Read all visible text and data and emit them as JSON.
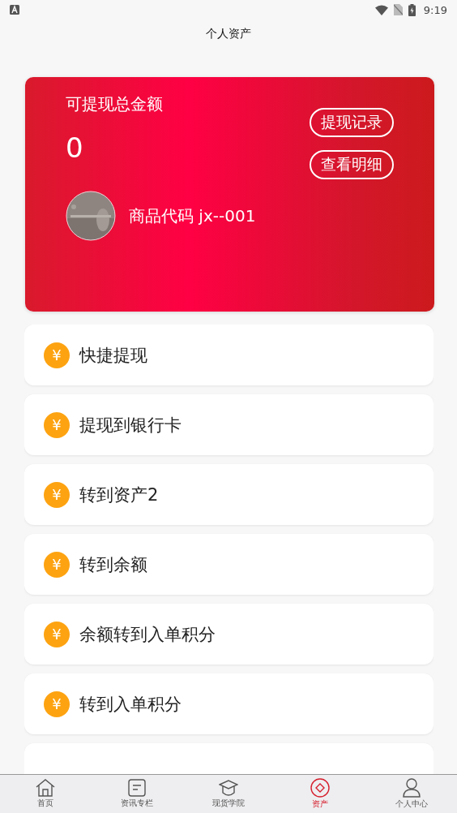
{
  "status_bar": {
    "time": "9:19"
  },
  "header": {
    "title": "个人资产"
  },
  "balance_card": {
    "label": "可提现总金额",
    "amount": "0",
    "buttons": [
      "提现记录",
      "查看明细"
    ],
    "product_code": "商品代码 jx--001"
  },
  "actions": [
    {
      "icon": "¥",
      "label": "快捷提现"
    },
    {
      "icon": "¥",
      "label": "提现到银行卡"
    },
    {
      "icon": "¥",
      "label": "转到资产2"
    },
    {
      "icon": "¥",
      "label": "转到余额"
    },
    {
      "icon": "¥",
      "label": "余额转到入单积分"
    },
    {
      "icon": "¥",
      "label": "转到入单积分"
    }
  ],
  "tab_bar": [
    {
      "kind": "home",
      "label": "首页",
      "selected": false
    },
    {
      "kind": "news",
      "label": "资讯专栏",
      "selected": false
    },
    {
      "kind": "academy",
      "label": "现货学院",
      "selected": false
    },
    {
      "kind": "assets",
      "label": "资产",
      "selected": true
    },
    {
      "kind": "profile",
      "label": "个人中心",
      "selected": false
    }
  ]
}
